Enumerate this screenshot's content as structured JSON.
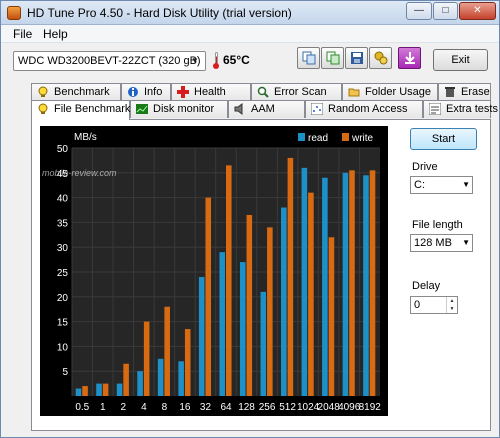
{
  "window": {
    "title": "HD Tune Pro 4.50 - Hard Disk Utility (trial version)"
  },
  "titlebar_buttons": {
    "minimize": "—",
    "maximize": "□",
    "close": "✕"
  },
  "menu": [
    {
      "label": "File"
    },
    {
      "label": "Help"
    }
  ],
  "toolbar": {
    "drive": "WDC WD3200BEVT-22ZCT     (320 gB)",
    "temperature": "65°C",
    "exit_label": "Exit",
    "icons": [
      "copy-icon",
      "copy-all-icon",
      "save-icon",
      "options-icon",
      "download-icon"
    ]
  },
  "tabs_top": [
    {
      "label": "Benchmark",
      "icon": "benchmark-icon"
    },
    {
      "label": "Info",
      "icon": "info-icon"
    },
    {
      "label": "Health",
      "icon": "health-icon"
    },
    {
      "label": "Error Scan",
      "icon": "error-scan-icon"
    },
    {
      "label": "Folder Usage",
      "icon": "folder-icon"
    },
    {
      "label": "Erase",
      "icon": "erase-icon"
    }
  ],
  "tabs_bottom": [
    {
      "label": "File Benchmark",
      "icon": "file-benchmark-icon",
      "active": true
    },
    {
      "label": "Disk monitor",
      "icon": "disk-monitor-icon"
    },
    {
      "label": "AAM",
      "icon": "speaker-icon"
    },
    {
      "label": "Random Access",
      "icon": "random-access-icon"
    },
    {
      "label": "Extra tests",
      "icon": "extra-tests-icon"
    }
  ],
  "side": {
    "start_label": "Start",
    "drive_label": "Drive",
    "drive_value": "C:",
    "file_length_label": "File length",
    "file_length_value": "128 MB",
    "delay_label": "Delay",
    "delay_value": "0"
  },
  "watermark": "mobile-review.com",
  "colors": {
    "read": "#1e90c8",
    "write": "#d86a12",
    "chart_bg": "#000000",
    "grid": "#3a3a3a"
  },
  "chart_data": {
    "type": "bar",
    "ylabel": "MB/s",
    "ylim": [
      0,
      50
    ],
    "yticks": [
      5,
      10,
      15,
      20,
      25,
      30,
      35,
      40,
      45,
      50
    ],
    "grid": true,
    "legend_position": "top-right",
    "categories": [
      "0.5",
      "1",
      "2",
      "4",
      "8",
      "16",
      "32",
      "64",
      "128",
      "256",
      "512",
      "1024",
      "2048",
      "4096",
      "8192"
    ],
    "series": [
      {
        "name": "read",
        "values": [
          1.5,
          2.5,
          2.5,
          5,
          7.5,
          7,
          24,
          29,
          27,
          21,
          38,
          46,
          44,
          45,
          44.5
        ]
      },
      {
        "name": "write",
        "values": [
          2,
          2.5,
          6.5,
          15,
          18,
          13.5,
          40,
          46.5,
          36.5,
          34,
          48,
          41,
          32,
          45.5,
          45.5
        ]
      }
    ]
  }
}
